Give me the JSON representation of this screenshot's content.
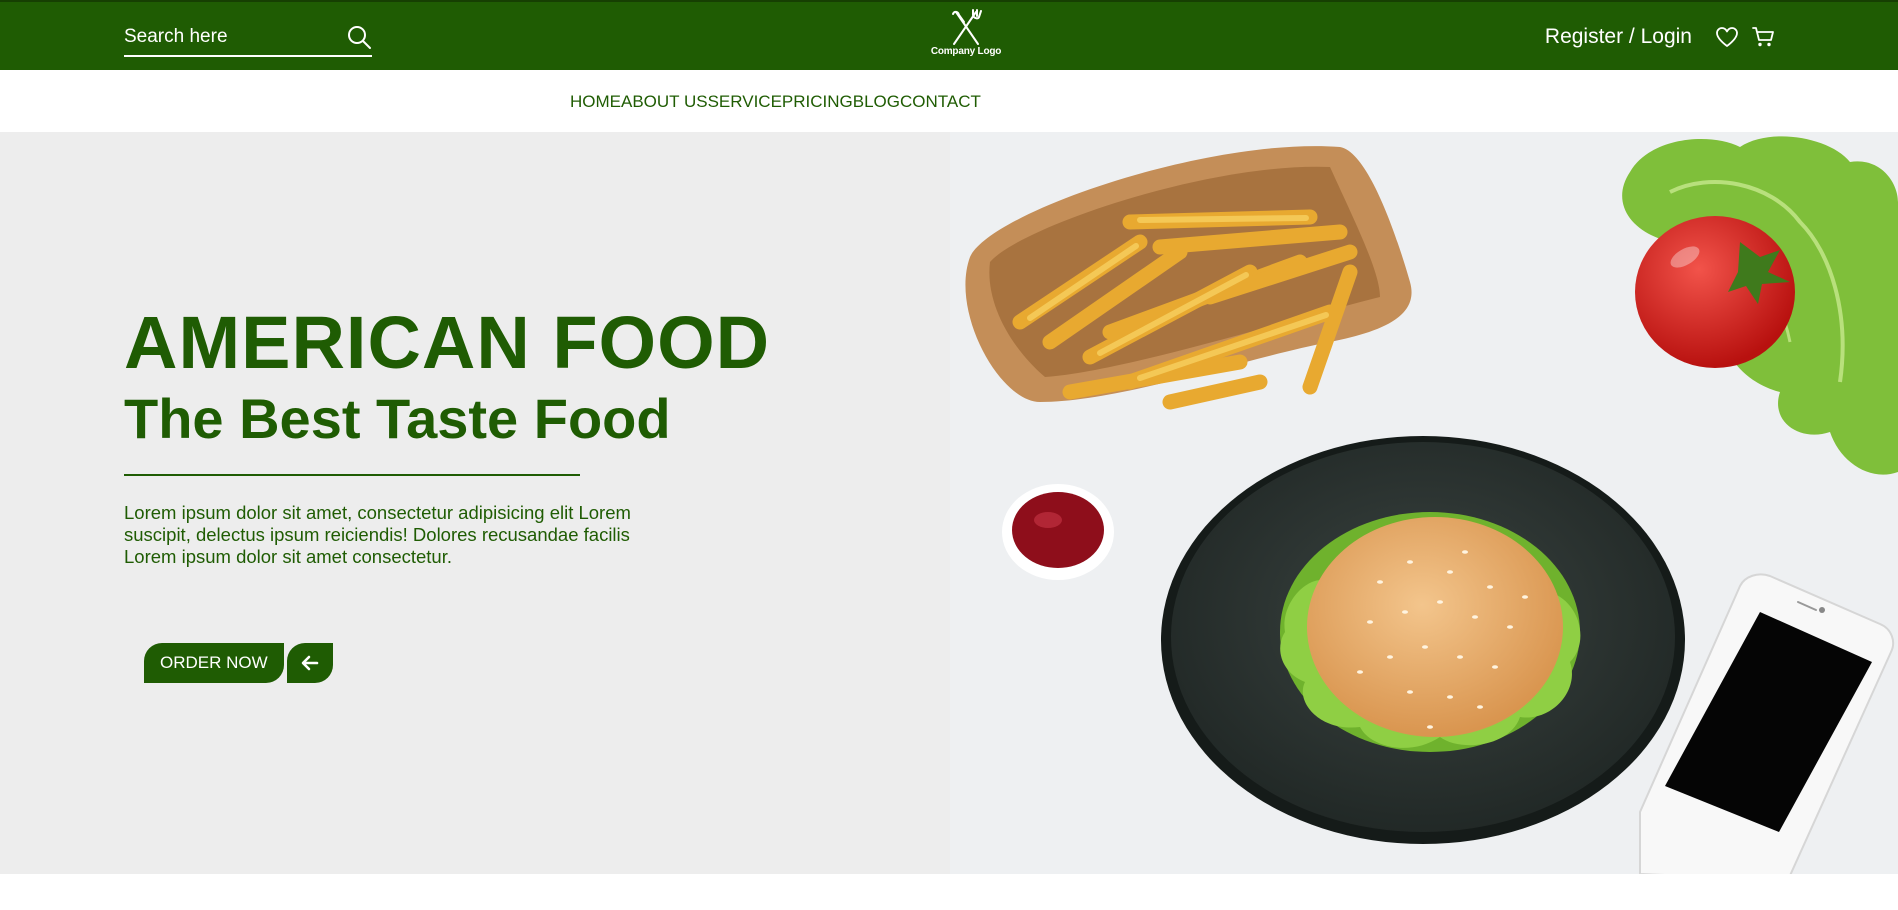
{
  "colors": {
    "brand": "#1f5c03",
    "hero_bg": "#ededed",
    "white": "#ffffff"
  },
  "header": {
    "search": {
      "placeholder": "Search here",
      "icon": "search-icon"
    },
    "logo": {
      "icon": "fork-knife-icon",
      "text": "Company Logo"
    },
    "account": {
      "login_label": "Register / Login",
      "wishlist_icon": "heart-icon",
      "cart_icon": "cart-icon"
    }
  },
  "nav": {
    "items": [
      {
        "label": "HOME"
      },
      {
        "label": "ABOUT US"
      },
      {
        "label": "SERVICE"
      },
      {
        "label": "PRICING"
      },
      {
        "label": "BLOG"
      },
      {
        "label": "CONTACT"
      }
    ]
  },
  "hero": {
    "title": "AMERICAN FOOD",
    "subtitle": "The Best Taste Food",
    "description": "Lorem ipsum dolor sit amet, consectetur adipisicing elit Lorem suscipit, delectus ipsum reiciendis! Dolores recusandae facilis Lorem ipsum dolor sit amet consectetur.",
    "order_label": "ORDER NOW",
    "arrow_icon": "arrow-left-icon"
  }
}
